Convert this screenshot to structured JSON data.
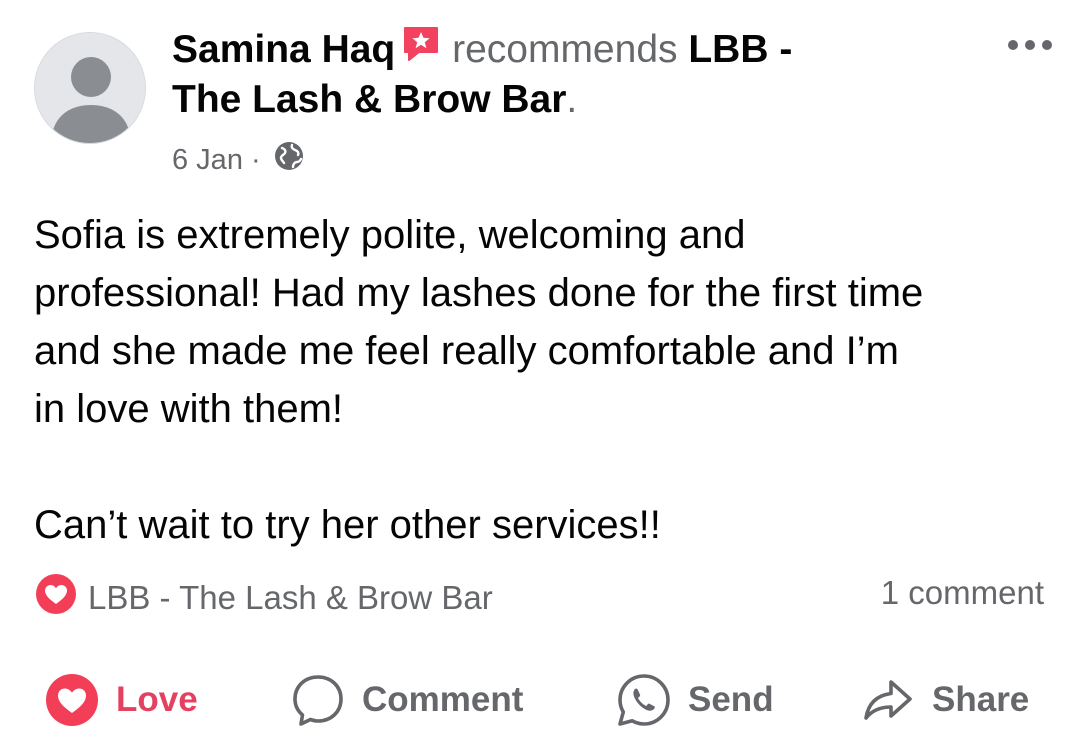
{
  "post": {
    "author": "Samina Haq",
    "verb": "recommends",
    "page_name_line1": "LBB -",
    "page_name_line2": "The Lash & Brow Bar",
    "trailing": ".",
    "date": "6 Jan",
    "separator": "·",
    "privacy_icon": "globe-icon",
    "recommend_badge_icon": "recommend-badge-icon",
    "body": "Sofia is extremely polite, welcoming and\nprofessional! Had my lashes done for the first time\nand she made me feel really comfortable and I’m\nin love with them!\n\nCan’t wait to try her other services!!"
  },
  "reactions": {
    "icon": "heart-reaction-icon",
    "label": "LBB - The Lash & Brow Bar",
    "comments_count": "1 comment"
  },
  "actions": {
    "love": "Love",
    "comment": "Comment",
    "send": "Send",
    "share": "Share"
  },
  "colors": {
    "love_red": "#e4405f",
    "secondary_text": "#65676b",
    "primary_text": "#050505"
  }
}
